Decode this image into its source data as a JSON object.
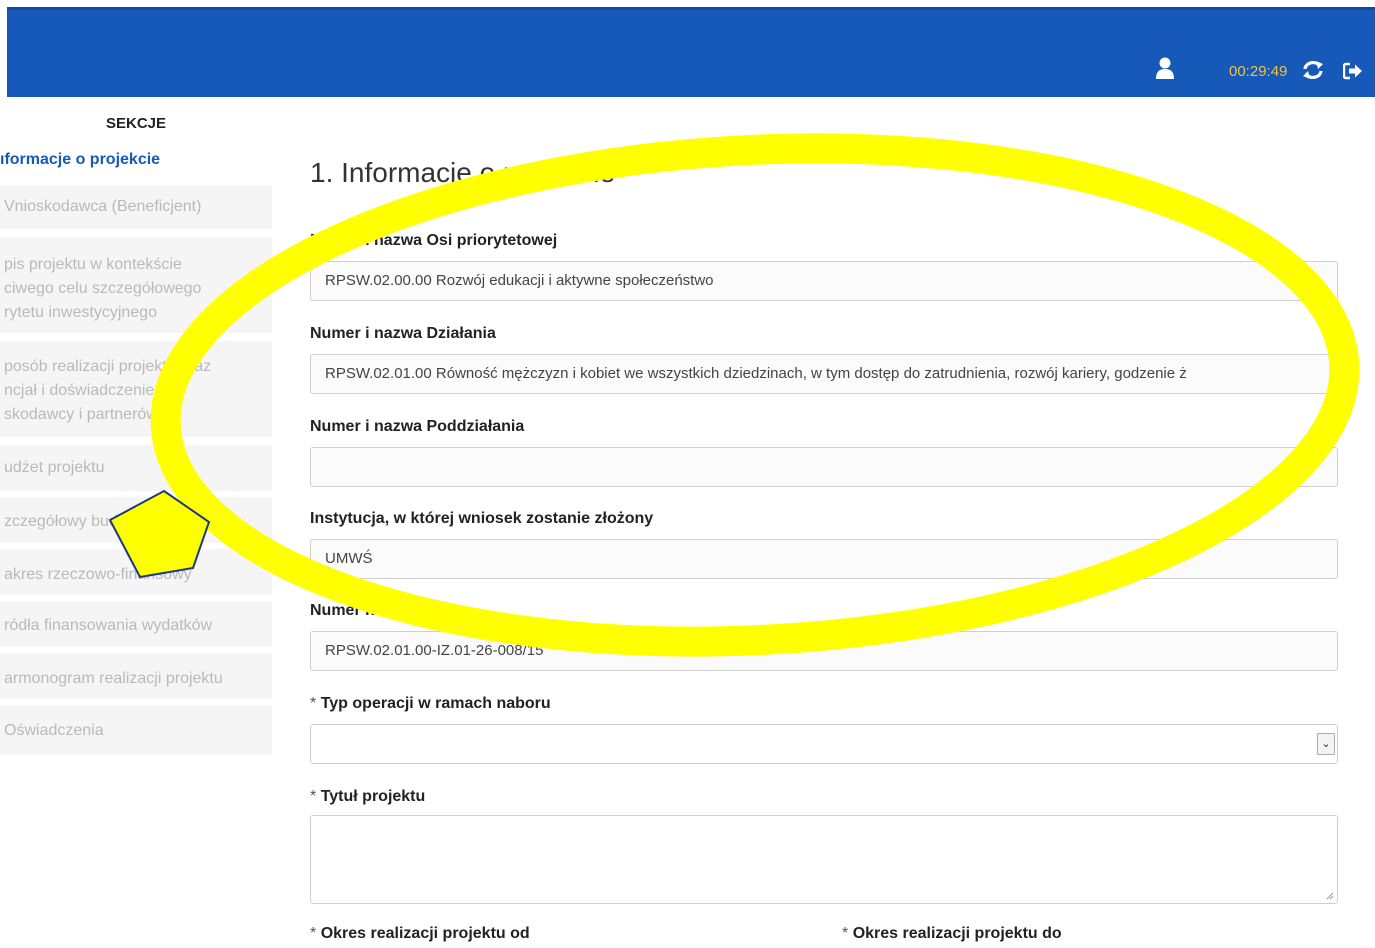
{
  "header": {
    "timer": "00:29:49",
    "user_icon": "user-icon",
    "refresh_icon": "refresh-icon",
    "logout_icon": "logout-icon"
  },
  "sidebar": {
    "title": "SEKCJE",
    "active_label": "ıformacje o projekcie",
    "items": [
      {
        "label": "Vnioskodawca (Beneficjent)"
      },
      {
        "label": "pis projektu w kontekście\nciwego celu szczegółowego\nrytetu inwestycyjnego"
      },
      {
        "label": "posób realizacji projektu oraz\nncjał i doświadczenie\nskodawcy i partnerów"
      },
      {
        "label": "udżet projektu"
      },
      {
        "label": "zczegółowy budżet projektu"
      },
      {
        "label": "akres rzeczowo-finansowy"
      },
      {
        "label": "ródła finansowania wydatków"
      },
      {
        "label": "armonogram realizacji projektu"
      },
      {
        "label": "Oświadczenia"
      }
    ]
  },
  "main": {
    "section_title": "1. Informacje o projekcie",
    "fields": [
      {
        "label": "Numer i nazwa Osi priorytetowej",
        "value": "RPSW.02.00.00 Rozwój edukacji i aktywne społeczeństwo"
      },
      {
        "label": "Numer i nazwa Działania",
        "value": "RPSW.02.01.00 Równość mężczyzn i kobiet we wszystkich dziedzinach, w tym dostęp do zatrudnienia, rozwój kariery, godzenie ż"
      },
      {
        "label": "Numer i nazwa Poddziałania",
        "value": ""
      },
      {
        "label": "Instytucja, w której wniosek zostanie złożony",
        "value": "UMWŚ"
      },
      {
        "label": "Numer naboru",
        "value": "RPSW.02.01.00-IZ.01-26-008/15"
      }
    ],
    "required_mark": "*",
    "operation_type_label": "Typ operacji w ramach naboru",
    "operation_type_value": "",
    "title_label": "Tytuł projektu",
    "title_value": "",
    "period_from_label": "Okres realizacji projektu od",
    "period_to_label": "Okres realizacji projektu do"
  },
  "annotation_colors": {
    "highlight": "#ffff00",
    "outline": "#1f3a7a"
  }
}
